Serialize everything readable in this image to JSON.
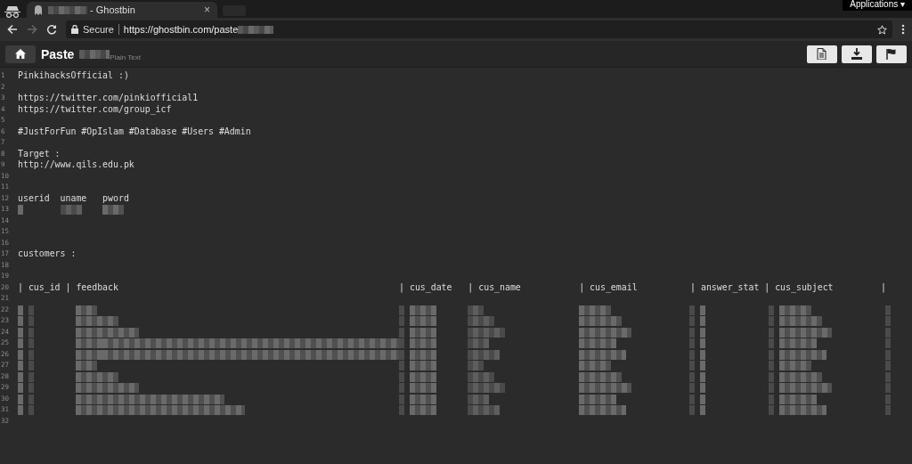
{
  "browser": {
    "tab": {
      "title": "- Ghostbin",
      "close": "×"
    },
    "applications_menu": {
      "label": "Applications",
      "caret": "▾"
    },
    "nav": {
      "back_disabled": false,
      "forward_disabled": true
    },
    "address": {
      "security": "Secure",
      "url": "https://ghostbin.com/paste"
    }
  },
  "paste": {
    "title": "Paste",
    "language": "Plain Text"
  },
  "lines": [
    {
      "number": "1",
      "kind": "text",
      "text": "PinkihacksOfficial :)"
    },
    {
      "number": "2",
      "kind": "blank"
    },
    {
      "number": "3",
      "kind": "text",
      "text": "https://twitter.com/pinkiofficial1"
    },
    {
      "number": "4",
      "kind": "text",
      "text": "https://twitter.com/group_icf"
    },
    {
      "number": "5",
      "kind": "blank"
    },
    {
      "number": "6",
      "kind": "text",
      "text": "#JustForFun #OpIslam #Database #Users #Admin"
    },
    {
      "number": "7",
      "kind": "blank"
    },
    {
      "number": "8",
      "kind": "text",
      "text": "Target :"
    },
    {
      "number": "9",
      "kind": "text",
      "text": "http://www.qils.edu.pk"
    },
    {
      "number": "10",
      "kind": "blank"
    },
    {
      "number": "11",
      "kind": "blank"
    },
    {
      "number": "12",
      "kind": "text",
      "text": "userid  uname   pword"
    },
    {
      "number": "13",
      "kind": "redacted-user"
    },
    {
      "number": "14",
      "kind": "blank"
    },
    {
      "number": "15",
      "kind": "blank"
    },
    {
      "number": "16",
      "kind": "blank"
    },
    {
      "number": "17",
      "kind": "text",
      "text": "customers :"
    },
    {
      "number": "18",
      "kind": "blank"
    },
    {
      "number": "19",
      "kind": "blank"
    },
    {
      "number": "20",
      "kind": "text",
      "text": "| cus_id | feedback                                                     | cus_date   | cus_name           | cus_email          | answer_stat | cus_subject         |"
    },
    {
      "number": "21",
      "kind": "blank"
    },
    {
      "number": "22",
      "kind": "redacted-row"
    },
    {
      "number": "23",
      "kind": "redacted-row"
    },
    {
      "number": "24",
      "kind": "redacted-row"
    },
    {
      "number": "25",
      "kind": "redacted-row"
    },
    {
      "number": "26",
      "kind": "redacted-row"
    },
    {
      "number": "27",
      "kind": "redacted-row"
    },
    {
      "number": "28",
      "kind": "redacted-row"
    },
    {
      "number": "29",
      "kind": "redacted-row"
    },
    {
      "number": "30",
      "kind": "redacted-row"
    },
    {
      "number": "31",
      "kind": "redacted-row"
    },
    {
      "number": "32",
      "kind": "blank"
    }
  ]
}
